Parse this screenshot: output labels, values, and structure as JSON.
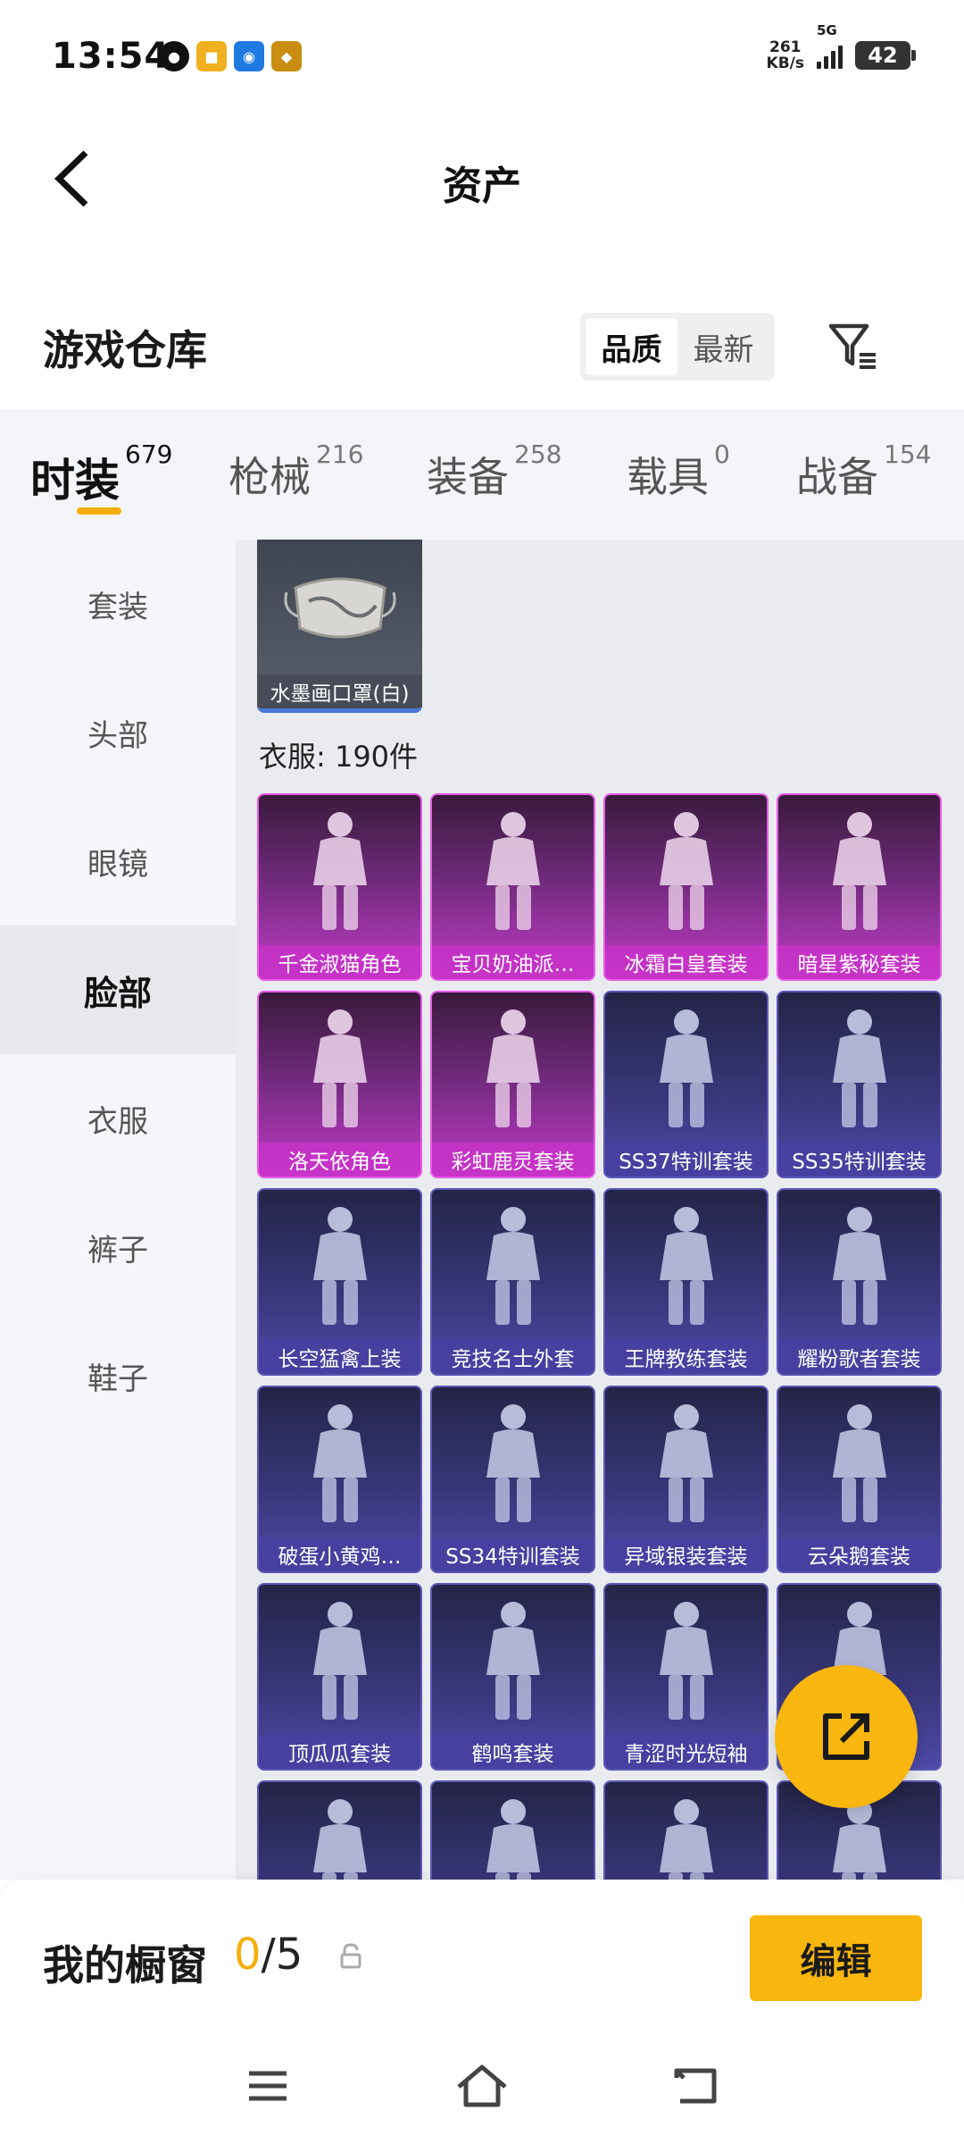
{
  "status_bar": {
    "time": "13:54",
    "net_speed_value": "261",
    "net_speed_unit": "KB/s",
    "network": "5G",
    "battery": "42"
  },
  "header": {
    "title": "资产"
  },
  "warehouse": {
    "title": "游戏仓库",
    "sort_options": [
      "品质",
      "最新"
    ],
    "active_sort": "品质"
  },
  "categories": [
    {
      "label": "时装",
      "count": "679",
      "active": true
    },
    {
      "label": "枪械",
      "count": "216"
    },
    {
      "label": "装备",
      "count": "258"
    },
    {
      "label": "载具",
      "count": "0"
    },
    {
      "label": "战备",
      "count": "154"
    }
  ],
  "sidebar": {
    "items": [
      "套装",
      "头部",
      "眼镜",
      "脸部",
      "衣服",
      "裤子",
      "鞋子"
    ],
    "active": "脸部"
  },
  "face_items": [
    {
      "name": "水墨画口罩(白)",
      "rarity": "grey"
    }
  ],
  "clothes_section": {
    "label": "衣服: 190件"
  },
  "clothes_items": [
    {
      "name": "千金淑猫角色",
      "rarity": "pink"
    },
    {
      "name": "宝贝奶油派…",
      "rarity": "pink"
    },
    {
      "name": "冰霜白皇套装",
      "rarity": "pink"
    },
    {
      "name": "暗星紫秘套装",
      "rarity": "pink"
    },
    {
      "name": "洛天依角色",
      "rarity": "pink"
    },
    {
      "name": "彩虹鹿灵套装",
      "rarity": "pink"
    },
    {
      "name": "SS37特训套装",
      "rarity": "purple"
    },
    {
      "name": "SS35特训套装",
      "rarity": "purple"
    },
    {
      "name": "长空猛禽上装",
      "rarity": "purple"
    },
    {
      "name": "竞技名士外套",
      "rarity": "purple"
    },
    {
      "name": "王牌教练套装",
      "rarity": "purple"
    },
    {
      "name": "耀粉歌者套装",
      "rarity": "purple"
    },
    {
      "name": "破蛋小黄鸡…",
      "rarity": "purple"
    },
    {
      "name": "SS34特训套装",
      "rarity": "purple"
    },
    {
      "name": "异域银装套装",
      "rarity": "purple"
    },
    {
      "name": "云朵鹅套装",
      "rarity": "purple"
    },
    {
      "name": "顶瓜瓜套装",
      "rarity": "purple"
    },
    {
      "name": "鹤鸣套装",
      "rarity": "purple"
    },
    {
      "name": "青涩时光短袖",
      "rarity": "purple"
    },
    {
      "name": "",
      "rarity": "purple"
    },
    {
      "name": "",
      "rarity": "purple"
    },
    {
      "name": "",
      "rarity": "purple"
    },
    {
      "name": "",
      "rarity": "purple"
    },
    {
      "name": "",
      "rarity": "purple"
    }
  ],
  "showcase": {
    "label": "我的橱窗",
    "current": "0",
    "total": "/5",
    "edit_label": "编辑"
  },
  "icons": {
    "back": "back-arrow-icon",
    "filter": "filter-icon",
    "share": "share-external-icon",
    "lock": "lock-icon",
    "nav_menu": "menu-icon",
    "nav_home": "home-icon",
    "nav_back": "back-icon"
  },
  "colors": {
    "accent": "#f8b60e",
    "legendary": "#c23cc8",
    "epic": "#4f49a8"
  }
}
